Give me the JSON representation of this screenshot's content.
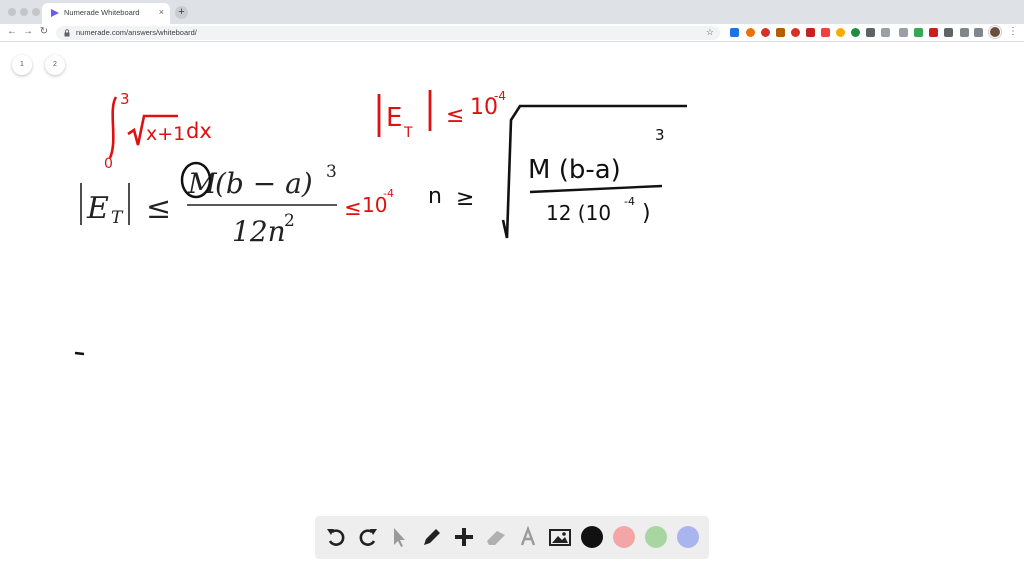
{
  "browser": {
    "tab_title": "Numerade Whiteboard",
    "tab_close": "×",
    "new_tab": "+",
    "url": "numerade.com/answers/whiteboard/"
  },
  "pages": [
    "1",
    "2"
  ],
  "whiteboard": {
    "typeset_formula": {
      "lhs_letter": "E",
      "lhs_subscript": "T",
      "relation": "≤",
      "numerator_M": "M",
      "numerator_rest": "(b − a)",
      "numerator_exponent": "3",
      "denominator_base": "12n",
      "denominator_exponent": "2"
    },
    "handwriting_red": {
      "integral_upper": "3",
      "integral_lower": "0",
      "integrand": "x+1",
      "differential": "dx",
      "error_letter": "E",
      "error_subscript": "T",
      "error_bound_relation": "≤",
      "error_bound_base": "10",
      "error_bound_exponent": "-4",
      "inline_bound_relation": "≤",
      "inline_bound_base": "10",
      "inline_bound_exponent": "-4"
    },
    "handwriting_black": {
      "n_label": "n",
      "relation": "≥",
      "numerator": "M (b-a)",
      "numerator_exponent": "3",
      "denominator": "12 (10",
      "denominator_exponent": "-4",
      "denominator_close": ")"
    }
  },
  "toolbar": {
    "colors": {
      "black": "#111111",
      "red": "#f4a6a6",
      "green": "#a8d5a2",
      "blue": "#aab4ee"
    }
  }
}
